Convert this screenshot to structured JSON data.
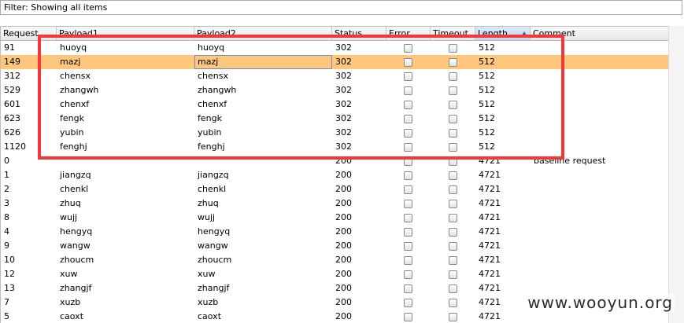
{
  "filter": {
    "text": "Filter:  Showing all items"
  },
  "columns": [
    {
      "key": "request",
      "label": "Request"
    },
    {
      "key": "payload1",
      "label": "Payload1"
    },
    {
      "key": "payload2",
      "label": "Payload2"
    },
    {
      "key": "status",
      "label": "Status"
    },
    {
      "key": "error",
      "label": "Error"
    },
    {
      "key": "timeout",
      "label": "Timeout"
    },
    {
      "key": "length",
      "label": "Length"
    },
    {
      "key": "comment",
      "label": "Comment"
    }
  ],
  "sorted_column": "length",
  "selected_row": 1,
  "rows": [
    {
      "request": "91",
      "payload1": "huoyq",
      "payload2": "huoyq",
      "status": "302",
      "error": false,
      "timeout": false,
      "length": "512",
      "comment": ""
    },
    {
      "request": "149",
      "payload1": "mazj",
      "payload2": "mazj",
      "status": "302",
      "error": false,
      "timeout": false,
      "length": "512",
      "comment": ""
    },
    {
      "request": "312",
      "payload1": "chensx",
      "payload2": "chensx",
      "status": "302",
      "error": false,
      "timeout": false,
      "length": "512",
      "comment": ""
    },
    {
      "request": "529",
      "payload1": "zhangwh",
      "payload2": "zhangwh",
      "status": "302",
      "error": false,
      "timeout": false,
      "length": "512",
      "comment": ""
    },
    {
      "request": "601",
      "payload1": "chenxf",
      "payload2": "chenxf",
      "status": "302",
      "error": false,
      "timeout": false,
      "length": "512",
      "comment": ""
    },
    {
      "request": "623",
      "payload1": "fengk",
      "payload2": "fengk",
      "status": "302",
      "error": false,
      "timeout": false,
      "length": "512",
      "comment": ""
    },
    {
      "request": "626",
      "payload1": "yubin",
      "payload2": "yubin",
      "status": "302",
      "error": false,
      "timeout": false,
      "length": "512",
      "comment": ""
    },
    {
      "request": "1120",
      "payload1": "fenghj",
      "payload2": "fenghj",
      "status": "302",
      "error": false,
      "timeout": false,
      "length": "512",
      "comment": ""
    },
    {
      "request": "0",
      "payload1": "",
      "payload2": "",
      "status": "200",
      "error": false,
      "timeout": false,
      "length": "4721",
      "comment": "baseline request"
    },
    {
      "request": "1",
      "payload1": "jiangzq",
      "payload2": "jiangzq",
      "status": "200",
      "error": false,
      "timeout": false,
      "length": "4721",
      "comment": ""
    },
    {
      "request": "2",
      "payload1": "chenkl",
      "payload2": "chenkl",
      "status": "200",
      "error": false,
      "timeout": false,
      "length": "4721",
      "comment": ""
    },
    {
      "request": "3",
      "payload1": "zhuq",
      "payload2": "zhuq",
      "status": "200",
      "error": false,
      "timeout": false,
      "length": "4721",
      "comment": ""
    },
    {
      "request": "8",
      "payload1": "wujj",
      "payload2": "wujj",
      "status": "200",
      "error": false,
      "timeout": false,
      "length": "4721",
      "comment": ""
    },
    {
      "request": "4",
      "payload1": "hengyq",
      "payload2": "hengyq",
      "status": "200",
      "error": false,
      "timeout": false,
      "length": "4721",
      "comment": ""
    },
    {
      "request": "9",
      "payload1": "wangw",
      "payload2": "wangw",
      "status": "200",
      "error": false,
      "timeout": false,
      "length": "4721",
      "comment": ""
    },
    {
      "request": "10",
      "payload1": "zhoucm",
      "payload2": "zhoucm",
      "status": "200",
      "error": false,
      "timeout": false,
      "length": "4721",
      "comment": ""
    },
    {
      "request": "12",
      "payload1": "xuw",
      "payload2": "xuw",
      "status": "200",
      "error": false,
      "timeout": false,
      "length": "4721",
      "comment": ""
    },
    {
      "request": "13",
      "payload1": "zhangjf",
      "payload2": "zhangjf",
      "status": "200",
      "error": false,
      "timeout": false,
      "length": "4721",
      "comment": ""
    },
    {
      "request": "7",
      "payload1": "xuzb",
      "payload2": "xuzb",
      "status": "200",
      "error": false,
      "timeout": false,
      "length": "4721",
      "comment": ""
    },
    {
      "request": "5",
      "payload1": "caoxt",
      "payload2": "caoxt",
      "status": "200",
      "error": false,
      "timeout": false,
      "length": "4721",
      "comment": ""
    }
  ],
  "colors": {
    "selected_row": "#ffc77d",
    "annotation_box": "#f5373a"
  },
  "watermark": "www.wooyun.org"
}
